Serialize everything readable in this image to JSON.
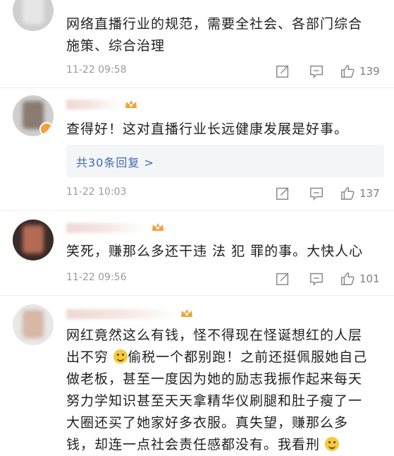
{
  "comments": [
    {
      "text_lines": [
        "网络直播行业的规范，需要全社会、各部门综合",
        "施策、综合治理"
      ],
      "time": "11-22 09:58",
      "likes": "139"
    },
    {
      "text_lines": [
        "查得好！这对直播行业长远健康发展是好事。"
      ],
      "replies_label": "共30条回复 >",
      "time": "11-22 10:03",
      "likes": "137"
    },
    {
      "text_lines": [
        "笑死，赚那么多还干违 法 犯 罪的事。大快人心"
      ],
      "time": "11-22 09:56",
      "likes": "101"
    },
    {
      "text_lines": [
        "网红竟然这么有钱，怪不得现在怪诞想红的人层",
        "出不穷",
        "偷税一个都别跑！之前还挺佩服她自己",
        "做老板，甚至一度因为她的励志我振作起来每天",
        "努力学知识甚至天天拿精华仪刷腿和肚子瘦了一",
        "大圈还买了她家好多衣服。真失望，赚那么多",
        "钱，却连一点社会责任感都没有。我看刑"
      ]
    }
  ],
  "icons": {
    "share": "share-icon",
    "comment": "comment-icon",
    "like": "thumbs-up-icon",
    "emoji": "smile-emoji-icon",
    "crown": "crown-badge-icon"
  },
  "colors": {
    "link": "#3a6bb0",
    "meta": "#9a9a9a",
    "crown": "#f2a23a"
  }
}
